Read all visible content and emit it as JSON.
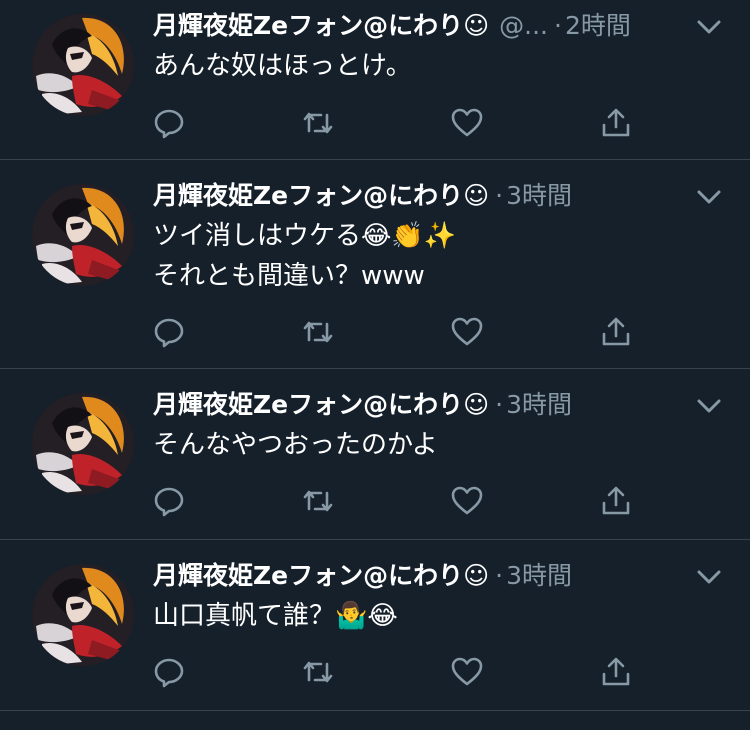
{
  "tweets": [
    {
      "name": "月輝夜姫Zeフォン@にわり☺",
      "handle": "@...",
      "separator": "·",
      "time": "2時間",
      "lines": [
        "あんな奴はほっとけ。"
      ]
    },
    {
      "name": "月輝夜姫Zeフォン@にわり☺",
      "handle": "",
      "separator": "·",
      "time": "3時間",
      "lines": [
        "ツイ消しはウケる😂👏✨",
        "それとも間違い？www"
      ]
    },
    {
      "name": "月輝夜姫Zeフォン@にわり☺",
      "handle": "",
      "separator": "·",
      "time": "3時間",
      "lines": [
        "そんなやつおったのかよ"
      ]
    },
    {
      "name": "月輝夜姫Zeフォン@にわり☺",
      "handle": "",
      "separator": "·",
      "time": "3時間",
      "lines": [
        "山口真帆て誰？🤷‍♂️😂"
      ]
    }
  ],
  "icons": {
    "reply": "reply-icon",
    "retweet": "retweet-icon",
    "like": "heart-icon",
    "share": "share-icon",
    "menu": "chevron-down-icon"
  },
  "colors": {
    "background": "#15202b",
    "divider": "#38444d",
    "secondary_text": "#8899a6",
    "primary_text": "#ffffff"
  }
}
